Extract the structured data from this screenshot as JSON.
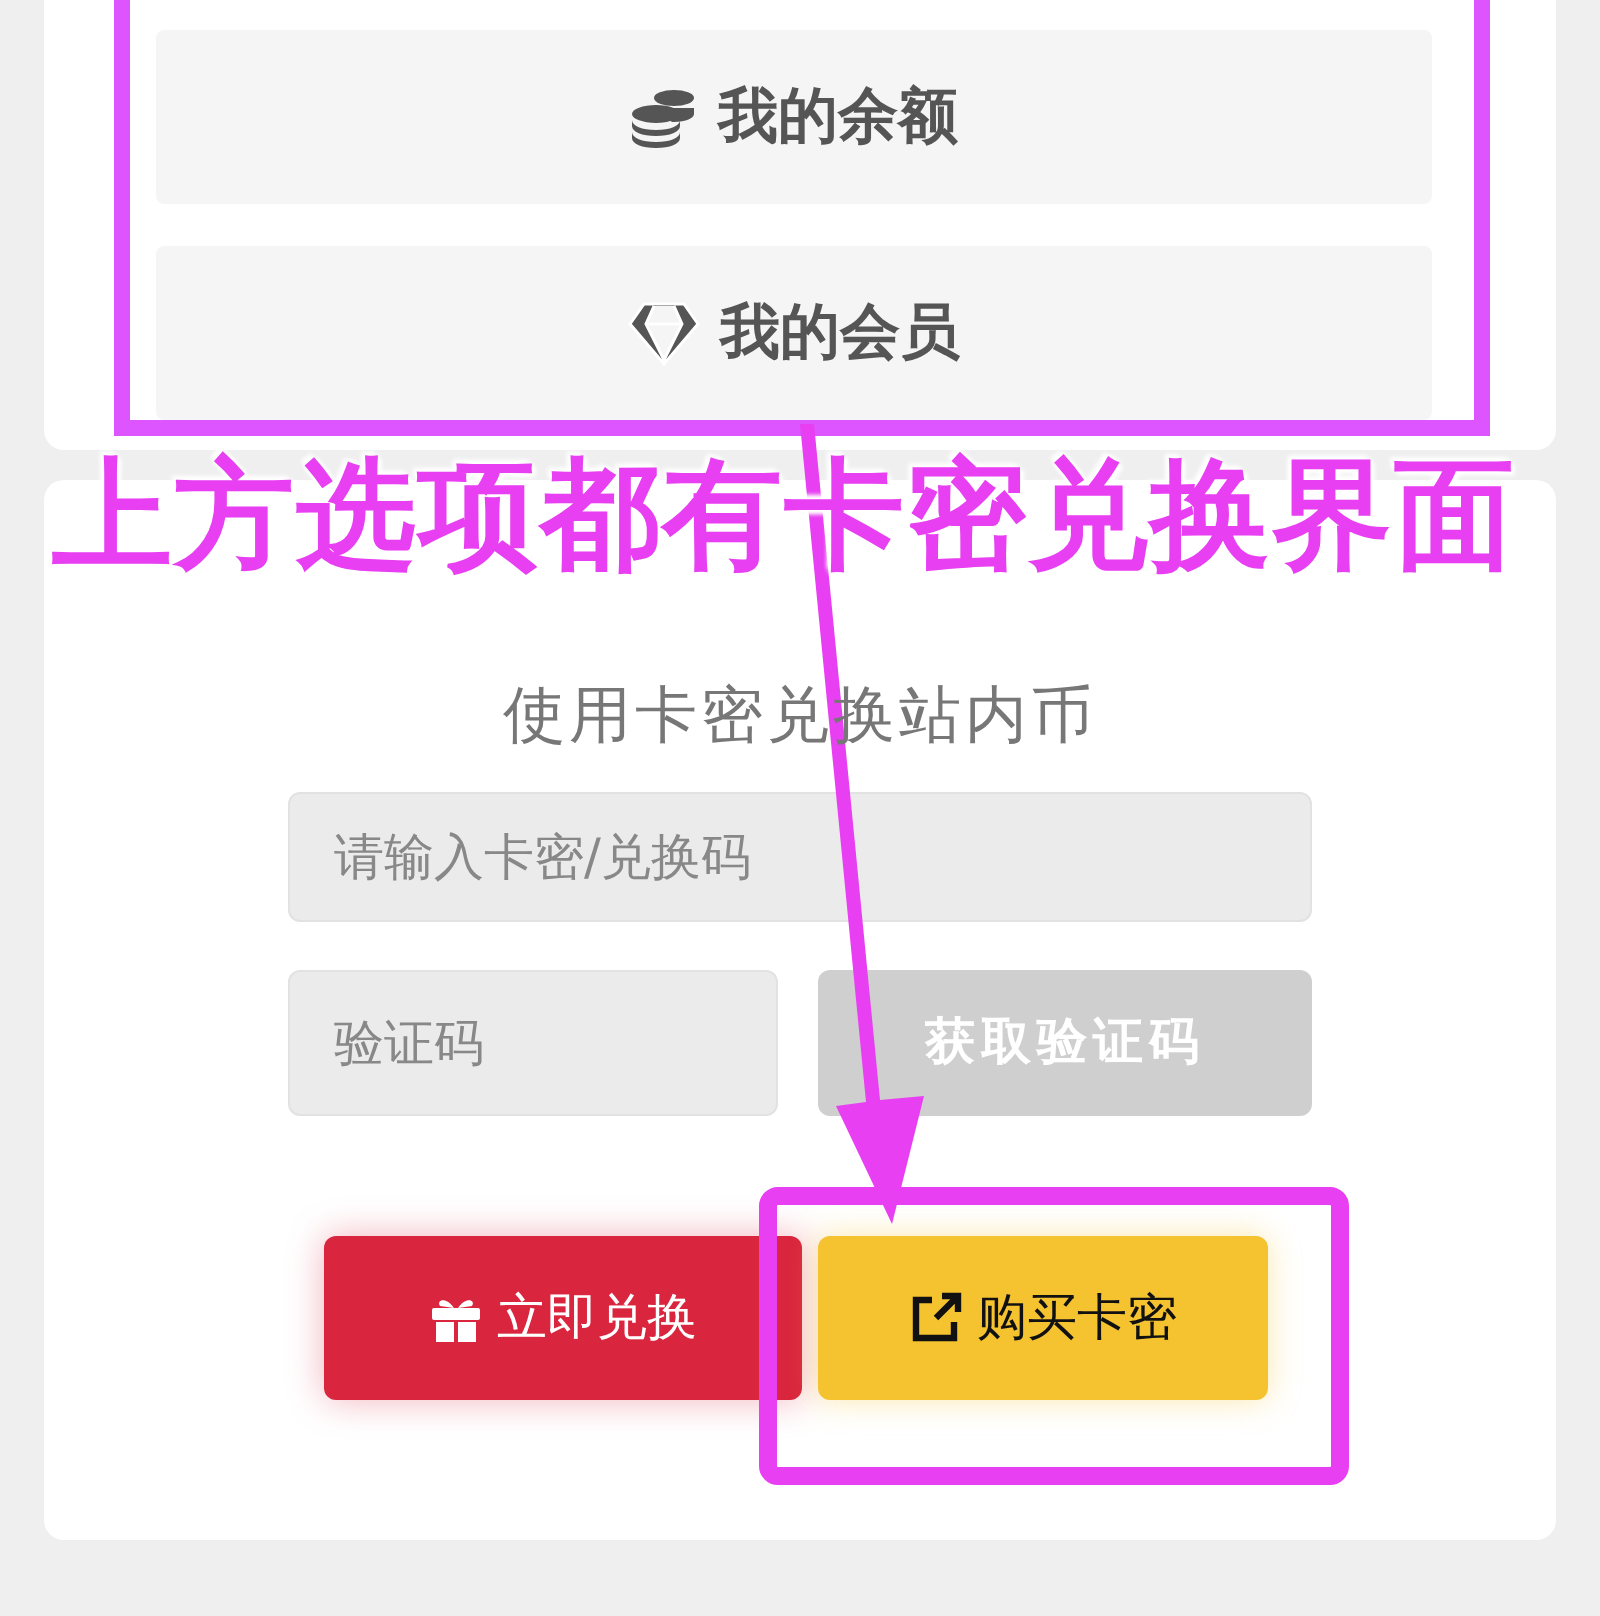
{
  "menu_buttons": [
    {
      "label": "我的余额",
      "kind": "coins"
    },
    {
      "label": "我的会员",
      "kind": "gem"
    }
  ],
  "redeem": {
    "subtitle": "使用卡密兑换站内币",
    "code_field": {
      "placeholder": "请输入卡密/兑换码"
    },
    "captcha_field": {
      "placeholder": "验证码"
    },
    "captcha_button": {
      "label": "获取验证码",
      "disabled": true
    },
    "actions": [
      {
        "label": "立即兑换",
        "kind": "redeem"
      },
      {
        "label": "购买卡密",
        "kind": "buy"
      }
    ]
  },
  "annotation": {
    "caption": "上方选项都有卡密兑换界面"
  }
}
